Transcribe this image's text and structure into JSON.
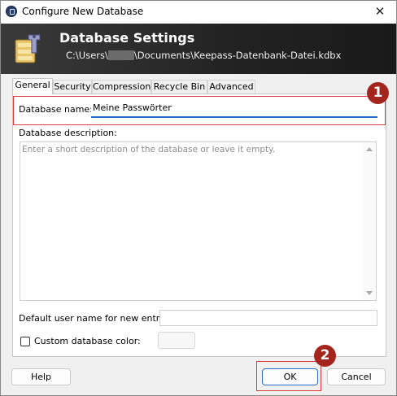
{
  "window": {
    "title": "Configure New Database",
    "close_glyph": "✕",
    "app_icon": "keepass-lock-icon"
  },
  "banner": {
    "icon": "database-settings-icon",
    "title": "Database Settings",
    "path_prefix": "C:\\Users\\",
    "path_suffix": "\\Documents\\Keepass-Datenbank-Datei.kdbx"
  },
  "tabs": [
    "General",
    "Security",
    "Compression",
    "Recycle Bin",
    "Advanced"
  ],
  "active_tab": "General",
  "general": {
    "name_label": "Database name:",
    "name_value": "Meine Passwörter",
    "description_label": "Database description:",
    "description_placeholder": "Enter a short description of the database or leave it empty.",
    "default_user_label": "Default user name for new entries:",
    "default_user_value": "",
    "custom_color_label": "Custom database color:",
    "custom_color_checked": false
  },
  "buttons": {
    "help": "Help",
    "ok": "OK",
    "cancel": "Cancel"
  },
  "annotations": {
    "marker_1": "1",
    "marker_2": "2",
    "highlight_color": "#e03a3a",
    "marker_color": "#a3251d"
  },
  "colors": {
    "accent": "#1f6fd0",
    "banner_dark": "#222222"
  }
}
